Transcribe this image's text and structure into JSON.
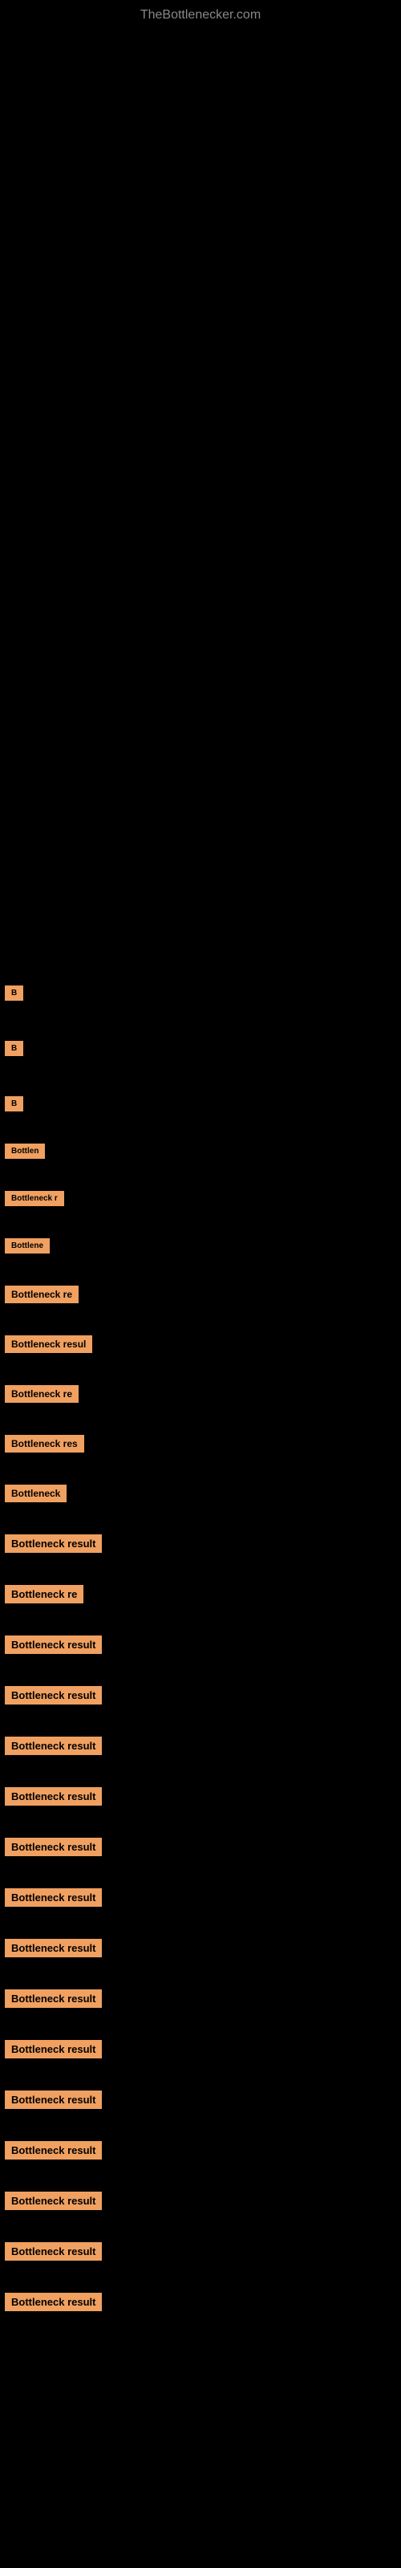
{
  "header": {
    "site_title": "TheBottlenecker.com"
  },
  "rows": [
    {
      "id": 1,
      "label": "B",
      "size": "small"
    },
    {
      "id": 2,
      "label": "B",
      "size": "small"
    },
    {
      "id": 3,
      "label": "B",
      "size": "small"
    },
    {
      "id": 4,
      "label": "Bottlen",
      "size": "small"
    },
    {
      "id": 5,
      "label": "Bottleneck r",
      "size": "small"
    },
    {
      "id": 6,
      "label": "Bottlene",
      "size": "small"
    },
    {
      "id": 7,
      "label": "Bottleneck re",
      "size": "medium"
    },
    {
      "id": 8,
      "label": "Bottleneck resul",
      "size": "medium"
    },
    {
      "id": 9,
      "label": "Bottleneck re",
      "size": "medium"
    },
    {
      "id": 10,
      "label": "Bottleneck res",
      "size": "medium"
    },
    {
      "id": 11,
      "label": "Bottleneck",
      "size": "medium"
    },
    {
      "id": 12,
      "label": "Bottleneck result",
      "size": "full"
    },
    {
      "id": 13,
      "label": "Bottleneck re",
      "size": "full"
    },
    {
      "id": 14,
      "label": "Bottleneck result",
      "size": "full"
    },
    {
      "id": 15,
      "label": "Bottleneck result",
      "size": "full"
    },
    {
      "id": 16,
      "label": "Bottleneck result",
      "size": "full"
    },
    {
      "id": 17,
      "label": "Bottleneck result",
      "size": "full"
    },
    {
      "id": 18,
      "label": "Bottleneck result",
      "size": "full"
    },
    {
      "id": 19,
      "label": "Bottleneck result",
      "size": "full"
    },
    {
      "id": 20,
      "label": "Bottleneck result",
      "size": "full"
    },
    {
      "id": 21,
      "label": "Bottleneck result",
      "size": "full"
    },
    {
      "id": 22,
      "label": "Bottleneck result",
      "size": "full"
    },
    {
      "id": 23,
      "label": "Bottleneck result",
      "size": "full"
    },
    {
      "id": 24,
      "label": "Bottleneck result",
      "size": "full"
    },
    {
      "id": 25,
      "label": "Bottleneck result",
      "size": "full"
    },
    {
      "id": 26,
      "label": "Bottleneck result",
      "size": "full"
    },
    {
      "id": 27,
      "label": "Bottleneck result",
      "size": "full"
    }
  ],
  "colors": {
    "background": "#000000",
    "label_bg": "#f0a060",
    "label_text": "#000000",
    "title": "#888888"
  }
}
